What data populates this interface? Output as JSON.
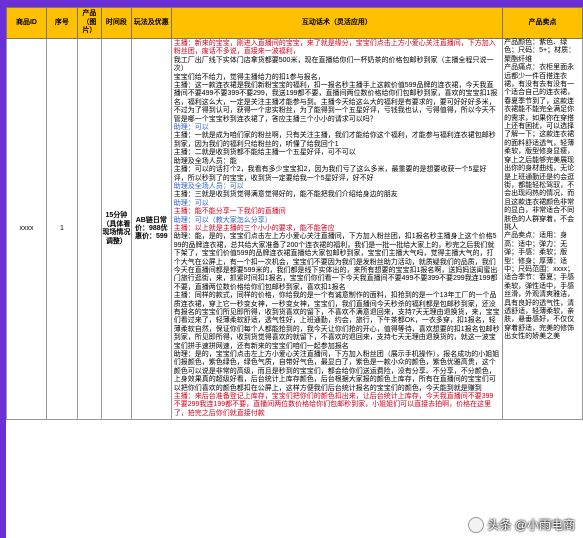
{
  "headers": {
    "product_id": "商品ID",
    "seq": "序号",
    "product_image": "产品（图片）",
    "time_slot": "时间段",
    "play_offer": "玩法及优惠",
    "script": "互动话术（灵活应用）",
    "selling_points": "产品卖点"
  },
  "row": {
    "product_id": "xxxx",
    "seq": "1",
    "time_slot": "15分钟（具体看现场情况调整）",
    "play_offer": "AB链日常价：988优惠价：599"
  },
  "script_lines": [
    {
      "role": "host",
      "text": "主播：新来的宝宝，刚进入直播间的宝宝，来了就是缘分，宝宝们点击上方小爱心关注直播间，下方加入粉丝团，废话不多说，直接来一波福利，"
    },
    {
      "role": "plain",
      "text": "我工厂出厂线下实体门店拿货都要500米，现在直播给你们一杯奶茶的价格包邮秒到家（主播全程只说一次）"
    },
    {
      "role": "plain",
      "text": "宝宝们给不给力，觉得主播给力的扣1参与报名，"
    },
    {
      "role": "plain",
      "text": "主播：这一款连衣裙是我们新粉宝宝的福利，扣一报名秒主播手上这款价值599品牌的连衣裙，今天我直播间不要499不要399不要299，我送199都不要，直播间两位数价格给你们包邮秒到家，喜欢的宝宝扣1报名，福利这么大，一定是关注主播才能参与到。主播今天给这么大的福利是有要求的，要可好好好多米，不过为了得到认可，获得一个忠实粉丝，为了能得到一个五星好评，亏钱我也认，亏得值得，所以今天不管是哪一个宝宝秒到连衣裙了，答应主播三个小小的请求可以吗？"
    },
    {
      "role": "assist",
      "text": "助理：可以"
    },
    {
      "role": "plain",
      "text": "主播：一就是成为咱们家的粉丝啊，只有关注主播，我们才能给你这个福利，才能参与福利连衣裙包邮秒到家，因为我们的福利只给粉丝的，听懂了给我回个1"
    },
    {
      "role": "plain",
      "text": "主播：二就是收到货都不能给主播一个五星好评，可不可以"
    },
    {
      "role": "plain",
      "text": "助理及全场人员：能"
    },
    {
      "role": "plain",
      "text": "主播：可以的话打个2，我看有多少宝宝扣2，因为我们亏了这么多米，最重要的是想要收获一个5星好评，所以秒到了的宝宝，收到货一定要给我一个5星好评，好不好"
    },
    {
      "role": "assist",
      "text": "助理及全场人员：可以"
    },
    {
      "role": "plain",
      "text": "主播：三就是收到货觉得满意觉得好的，能不能把我们介绍给身边的朋友"
    },
    {
      "role": "assist",
      "text": "助理：可以"
    },
    {
      "role": "host",
      "text": "主播：能不能分享一下我们的直播间"
    },
    {
      "role": "assist",
      "text": "助理：可以（教大家怎么分享）"
    },
    {
      "role": "host",
      "text": "主播：以上就是主播的三个小小的要求，能不能答应"
    },
    {
      "role": "plain",
      "text": "助理：能，是的，宝宝们点击左上方小爱心关注直播间，下方加入粉丝团，扣1报名秒主播身上这个价格599的品牌连衣裙，总共给大家准备了200个连衣裙的福利，我们是一批一批给大家上的，秒完之后我们就下架了，宝宝们价值599的品牌连衣裙直播给大家包邮秒到家，宝宝们主播大气吗，觉得主播大气的，打个大气在公屏上，有一个扣一次机会，宝宝们不要因为我们是发粉丝助力活动，就质疑我们的品质，我们今天在直播间都是都要599米的，我们都是线下实体出的，来所有想要的宝宝扣1报名啊，送妈妈送闺蜜出门旅行逛街，来，抓紧时间扣1报名，宝宝们你们看一下今天我直播间不要499不要399不要299我连199都不要，直播两位数价格给你们包邮秒到家，喜欢扣1报名"
    },
    {
      "role": "plain",
      "text": "主播：同样的款式，同样的价格，你给我的是一个有诚意制作的面料，扣抢到的是一个13年工厂的一个品质连衣裙，穿上它一秒变女神，一秒变女神，宝宝们，我们直播间今天秒杀的福利都是包邮秒到家，还没有报名的宝宝们所见即所得，收到货喜欢的留下，不喜欢不满意退回来，支持7天无理由退换货，来，宝宝们看过来了，轻薄柔软舒适，透气性好，上班通勤，约会，旅行，下午茶都OK，一衣多穿，扣1报名，轻薄柔软自然，保证你们每个人都能抢到的，我今天让你们抢的开心，值得等待，喜欢想要的扣1报名包邮秒到家，所见即所得，收到货觉得喜欢的就留下，不喜欢的退回来，支持七天无理由退换货的，就这一波宝宝们拼手速拼网速，还有新来的宝宝们咱们一起参加报名"
    },
    {
      "role": "plain",
      "text": "助理：是的，宝宝们点击左上方小爱心关注直播间，下方加入粉丝团（展示手机操作），报名成功的小姐姐们报颜色，紫色绿色，绿色气质，自带好气色，最显白了，紫色是一款小众的颜色，紫色优雅高贵，这个颜色可以说是非常的高级，而且是秒到的宝宝们，都会给你们送运费险，没有分享、不分享，不分颜色，上身效果真的超级好看，后台统计上库存颜色，后台根据大家报的颜色上库存，所有在直播间的宝宝们可以把你们喜欢的颜色都扣在公屏上，这样方便我们后台统计报名的宝宝们的颜色，今天能到就是赚到"
    },
    {
      "role": "host",
      "text": "主播：来后台准备登记上库存，宝宝们把你们的颜色扣出来，让后台统计上库存，今天我直播间不要399不要299我连199都不要，直播间两位数价格给你们包邮秒到家，小姐姐们可以直接去拍啊，价格在这里了，拍完之后你们就直接付款"
    }
  ],
  "selling_points": [
    "产品颜色：紫色、绿色；尺码：5+；材质：聚酯纤维",
    "产品痛点：衣柜里面永远都少一件百搭连衣裙，有没有去有没有一个适合自己的连衣裙，春夏季节到了，这款连衣裙能不能完全满足你的需求，如果你在穿搭上还有困扰，可以选择了解一下；这款连衣裙的面料舒适透气，轻薄柔软，版型修身显瘦，穿上之后能够完美展现出你的身材曲线，无论是上班通勤还是约会逛街，都能轻松驾驭，不会出现闷热的情况，而且这款连衣裙颜色非常的显白，非常适合不同肤色的人群穿着，不会挑人",
    "产品卖点：适用：身高：适中；弹力：无弹；手感：柔软；版型：修身；厚薄：适中；尺码范围：xxxx；适合季节：春夏；手感柔软，弹性适中，手感丝滑，外观清爽雅洁，具有良好的透气性，清透舒适，轻薄柔软，亲肤，悬垂感好，不仅仅穿着舒适，完美的修饰出女性的娇美之美"
  ],
  "watermark": "头条 @小雨电商"
}
